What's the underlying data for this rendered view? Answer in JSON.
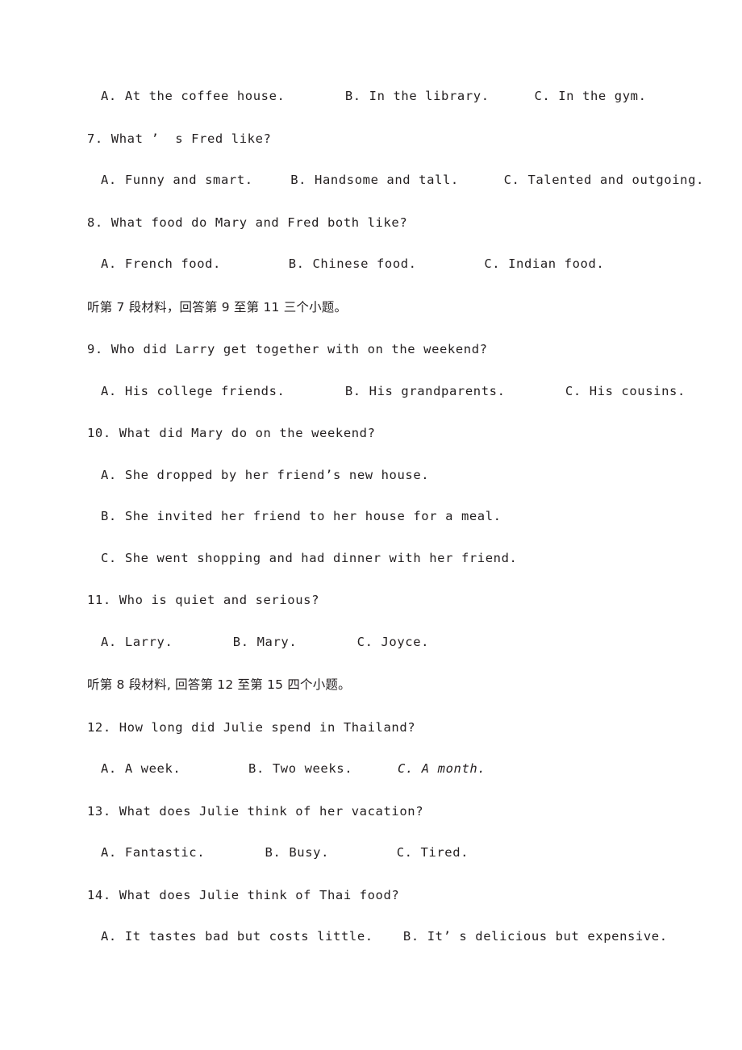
{
  "document": {
    "type": "exam-paper",
    "section": "listening-comprehension",
    "language": "en-zh",
    "text_color": "#231f20",
    "background_color": "#ffffff"
  },
  "blocks": [
    {
      "id": "q6-options",
      "kind": "options-inline",
      "options": [
        {
          "letter": "A.",
          "text": "At the coffee house.",
          "italic": false,
          "pad": 8
        },
        {
          "letter": "B.",
          "text": "In the library.",
          "italic": false,
          "pad": 6
        },
        {
          "letter": "C.",
          "text": "In the gym.",
          "italic": false,
          "pad": 0
        }
      ]
    },
    {
      "id": "q7-stem",
      "kind": "question",
      "text": "7. What ’  s Fred like?"
    },
    {
      "id": "q7-options",
      "kind": "options-inline",
      "options": [
        {
          "letter": "A.",
          "text": "Funny and smart.",
          "italic": false,
          "pad": 5
        },
        {
          "letter": "B.",
          "text": "Handsome and tall.",
          "italic": false,
          "pad": 6
        },
        {
          "letter": "C.",
          "text": "Talented and outgoing.",
          "italic": false,
          "pad": 0
        }
      ]
    },
    {
      "id": "q8-stem",
      "kind": "question",
      "text": "8. What food do Mary and Fred both like?"
    },
    {
      "id": "q8-options",
      "kind": "options-inline",
      "options": [
        {
          "letter": "A.",
          "text": "French food.",
          "italic": false,
          "pad": 9
        },
        {
          "letter": "B.",
          "text": "Chinese food.",
          "italic": false,
          "pad": 9
        },
        {
          "letter": "C.",
          "text": "Indian food.",
          "italic": false,
          "pad": 0
        }
      ]
    },
    {
      "id": "directive-7",
      "kind": "directive-cn",
      "text": "听第 7 段材料，回答第 9 至第 11 三个小题。"
    },
    {
      "id": "q9-stem",
      "kind": "question",
      "text": "9. Who did Larry get together with on the weekend?"
    },
    {
      "id": "q9-options",
      "kind": "options-inline",
      "options": [
        {
          "letter": "A.",
          "text": "His college friends.",
          "italic": false,
          "pad": 8
        },
        {
          "letter": "B.",
          "text": "His grandparents.",
          "italic": false,
          "pad": 8
        },
        {
          "letter": "C.",
          "text": "His cousins.",
          "italic": false,
          "pad": 0
        }
      ]
    },
    {
      "id": "q10-stem",
      "kind": "question",
      "text": "10. What did Mary do on the weekend?"
    },
    {
      "id": "q10-options",
      "kind": "options-stacked",
      "options": [
        {
          "letter": "A.",
          "text": "She dropped by her friend’s new house.",
          "italic": false
        },
        {
          "letter": "B.",
          "text": "She invited her friend to her house for a meal.",
          "italic": false
        },
        {
          "letter": "C.",
          "text": "She went shopping and had dinner with her friend.",
          "italic": false
        }
      ]
    },
    {
      "id": "q11-stem",
      "kind": "question",
      "text": "11. Who is quiet and serious?"
    },
    {
      "id": "q11-options",
      "kind": "options-inline",
      "options": [
        {
          "letter": "A.",
          "text": "Larry.",
          "italic": false,
          "pad": 8
        },
        {
          "letter": "B.",
          "text": "Mary.",
          "italic": false,
          "pad": 8
        },
        {
          "letter": "C.",
          "text": "Joyce.",
          "italic": false,
          "pad": 0
        }
      ]
    },
    {
      "id": "directive-8",
      "kind": "directive-cn",
      "text": "听第 8 段材料, 回答第 12 至第 15 四个小题。"
    },
    {
      "id": "q12-stem",
      "kind": "question",
      "text": "12. How long did Julie spend in Thailand?"
    },
    {
      "id": "q12-options",
      "kind": "options-inline",
      "options": [
        {
          "letter": "A.",
          "text": "A week.",
          "italic": false,
          "pad": 9
        },
        {
          "letter": "B.",
          "text": "Two weeks.",
          "italic": false,
          "pad": 6
        },
        {
          "letter": "C.",
          "text": "A month.",
          "italic": true,
          "pad": 0
        }
      ]
    },
    {
      "id": "q13-stem",
      "kind": "question",
      "text": "13. What does Julie think of her vacation?"
    },
    {
      "id": "q13-options",
      "kind": "options-inline",
      "options": [
        {
          "letter": "A.",
          "text": "Fantastic.",
          "italic": false,
          "pad": 8
        },
        {
          "letter": "B.",
          "text": "Busy.",
          "italic": false,
          "pad": 9
        },
        {
          "letter": "C.",
          "text": "Tired.",
          "italic": false,
          "pad": 0
        }
      ]
    },
    {
      "id": "q14-stem",
      "kind": "question",
      "text": "14. What does Julie think of Thai food?"
    },
    {
      "id": "q14-options",
      "kind": "options-inline",
      "options": [
        {
          "letter": "A.",
          "text": "It tastes bad but costs little.",
          "italic": false,
          "pad": 4
        },
        {
          "letter": "B.",
          "text": "It’ s delicious but expensive.",
          "italic": false,
          "pad": 0
        }
      ]
    }
  ]
}
